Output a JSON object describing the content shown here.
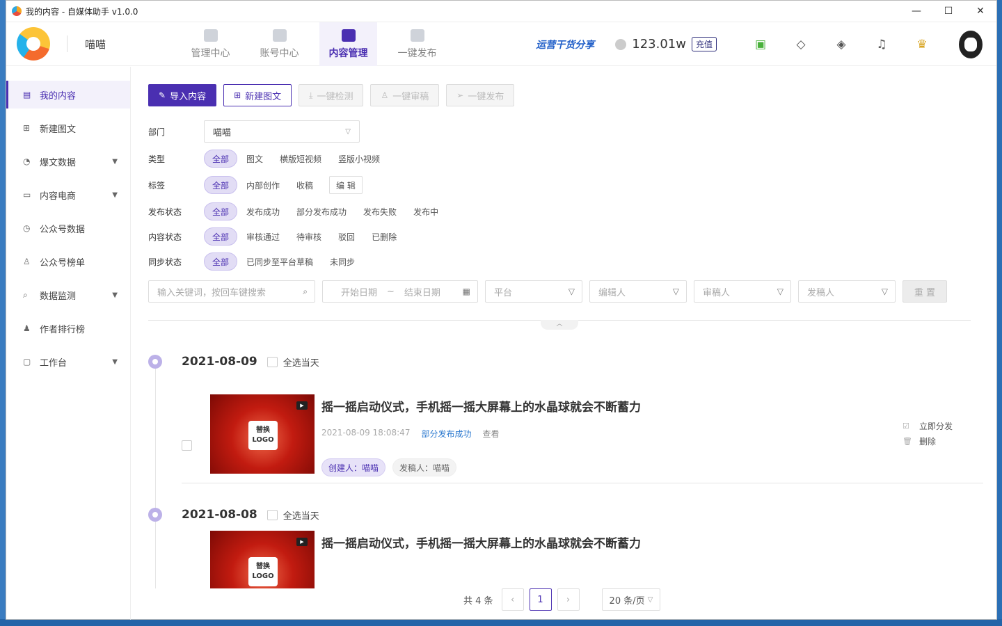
{
  "window": {
    "title": "我的内容 - 自媒体助手 v1.0.0",
    "controls": [
      "—",
      "☐",
      "✕"
    ]
  },
  "header": {
    "user_name": "喵喵",
    "nav": [
      {
        "label": "管理中心",
        "active": false
      },
      {
        "label": "账号中心",
        "active": false
      },
      {
        "label": "内容管理",
        "active": true
      },
      {
        "label": "一键发布",
        "active": false
      }
    ],
    "promo": "运营干货分享",
    "balance": "123.01w",
    "recharge": "充值",
    "accent": "#4a2fb1"
  },
  "sidebar": {
    "items": [
      {
        "label": "我的内容",
        "icon": "document-icon",
        "active": true,
        "expandable": false
      },
      {
        "label": "新建图文",
        "icon": "add-doc-icon",
        "active": false,
        "expandable": false
      },
      {
        "label": "爆文数据",
        "icon": "pie-chart-icon",
        "active": false,
        "expandable": true
      },
      {
        "label": "内容电商",
        "icon": "shop-icon",
        "active": false,
        "expandable": true
      },
      {
        "label": "公众号数据",
        "icon": "clock-icon",
        "active": false,
        "expandable": false
      },
      {
        "label": "公众号榜单",
        "icon": "trophy-icon",
        "active": false,
        "expandable": false
      },
      {
        "label": "数据监测",
        "icon": "search-icon",
        "active": false,
        "expandable": true
      },
      {
        "label": "作者排行榜",
        "icon": "user-list-icon",
        "active": false,
        "expandable": false
      },
      {
        "label": "工作台",
        "icon": "monitor-icon",
        "active": false,
        "expandable": true
      }
    ]
  },
  "toolbar": {
    "import": "导入内容",
    "new_article": "新建图文",
    "check": "一键检测",
    "review": "一键审稿",
    "publish": "一键发布"
  },
  "filters": {
    "department": {
      "label": "部门",
      "value": "喵喵"
    },
    "type": {
      "label": "类型",
      "options": [
        "全部",
        "图文",
        "横版短视频",
        "竖版小视频"
      ]
    },
    "tag": {
      "label": "标签",
      "options": [
        "全部",
        "内部创作",
        "收稿"
      ],
      "edit": "编 辑"
    },
    "publish_status": {
      "label": "发布状态",
      "options": [
        "全部",
        "发布成功",
        "部分发布成功",
        "发布失败",
        "发布中"
      ]
    },
    "content_status": {
      "label": "内容状态",
      "options": [
        "全部",
        "审核通过",
        "待审核",
        "驳回",
        "已删除"
      ]
    },
    "sync_status": {
      "label": "同步状态",
      "options": [
        "全部",
        "已同步至平台草稿",
        "未同步"
      ]
    }
  },
  "search": {
    "keyword_placeholder": "输入关键词，按回车键搜索",
    "start_date": "开始日期",
    "date_sep": "~",
    "end_date": "结束日期",
    "platform": "平台",
    "editor": "编辑人",
    "reviewer": "审稿人",
    "submitter": "发稿人",
    "reset": "重 置"
  },
  "days": [
    {
      "date": "2021-08-09",
      "select_all": "全选当天",
      "items": [
        {
          "title": "摇一摇启动仪式，手机摇一摇大屏幕上的水晶球就会不断蓄力",
          "time": "2021-08-09 18:08:47",
          "status": "部分发布成功",
          "view": "查看",
          "creator": "创建人：喵喵",
          "submitter": "发稿人：喵喵",
          "thumb_text": "替换\nLOGO",
          "actions": [
            "立即分发",
            "删除"
          ]
        }
      ]
    },
    {
      "date": "2021-08-08",
      "select_all": "全选当天",
      "items": [
        {
          "title": "摇一摇启动仪式，手机摇一摇大屏幕上的水晶球就会不断蓄力",
          "thumb_text": "替换\nLOGO"
        }
      ]
    }
  ],
  "pagination": {
    "total": "共 4 条",
    "current": "1",
    "page_size": "20 条/页"
  }
}
